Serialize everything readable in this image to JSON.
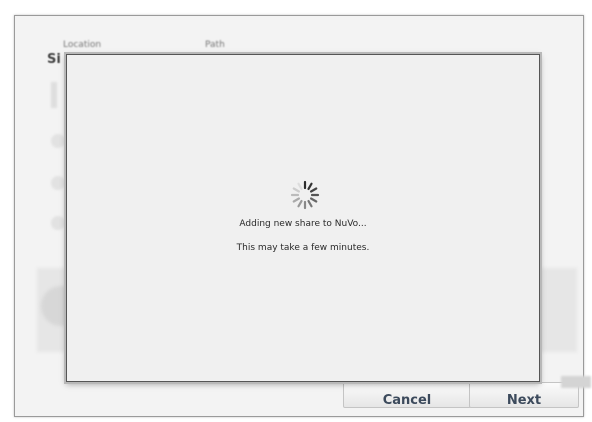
{
  "wizard": {
    "heading_partial": "Si",
    "column_headers": [
      "Location",
      "Path"
    ],
    "buttons": {
      "cancel_label": "Cancel",
      "next_label": "Next"
    }
  },
  "progress_dialog": {
    "message": "Adding new share to NuVo...",
    "submessage": "This may take a few minutes.",
    "spinner_icon": "loading-spinner-icon"
  }
}
